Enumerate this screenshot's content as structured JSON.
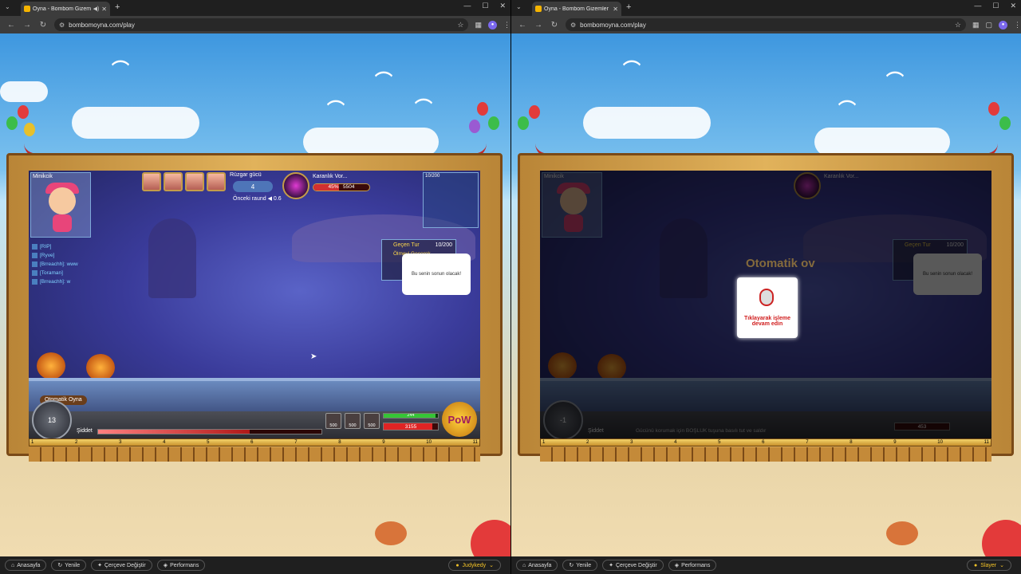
{
  "left": {
    "tab_title": "Oyna - Bombom Gizemler |",
    "url": "bombomoyna.com/play",
    "game": {
      "player_name": "Minikcik",
      "wind_label": "Rüzgar gücü",
      "wind_value": "4",
      "previous_round_label": "Önceki raund",
      "previous_round_value": "0.6",
      "boss_name": "Karanlık Vor...",
      "boss_hp_percent": 45,
      "boss_hp_text": "5504",
      "boss_hp_display": "45%",
      "minimap_top": "10/200",
      "chat": [
        "[RIP]",
        "[Ryve]",
        "[Brreachh]: www",
        "[Toraman]",
        "[Brreachh]: w"
      ],
      "turn_label": "Geçen Tur",
      "turn_value": "10/200",
      "objective_label": "Ölmeyi Geçerek",
      "speech": "Bu senin sonun olacak!",
      "auto_play": "Otomatik Oyna",
      "dial_value": "13",
      "power_label": "Şiddet",
      "power_percent": 68,
      "item_costs": [
        "500",
        "500",
        "500"
      ],
      "energy_value": "244",
      "energy_percent": 95,
      "hp_value": "3155",
      "hp_percent": 90,
      "pow_label": "PoW"
    },
    "ruler": [
      "1",
      "2",
      "3",
      "4",
      "5",
      "6",
      "7",
      "8",
      "9",
      "10",
      "11"
    ],
    "bottom": [
      "Anasayfa",
      "Yenile",
      "Çerçeve Değiştir",
      "Performans"
    ],
    "user": "Judykedy"
  },
  "right": {
    "tab_title": "Oyna - Bombom Gizemler Diy...",
    "url": "bombomoyna.com/play",
    "game": {
      "player_name": "Minikcik",
      "auto_title": "Otomatik ov",
      "start_label": "Tıklayarak işleme devam edin",
      "dial_value": "-1",
      "power_label": "Şiddet",
      "hint": "Gücünü korumak için BOŞLUK tuşuna basılı tut ve saldır",
      "hp_value": "453",
      "boss_name": "Karanlık Vor...",
      "turn_label": "Geçen Tur",
      "turn_value": "10/200",
      "speech": "Bu senin sonun olacak!"
    },
    "ruler": [
      "1",
      "2",
      "3",
      "4",
      "5",
      "6",
      "7",
      "8",
      "9",
      "10",
      "11"
    ],
    "bottom": [
      "Anasayfa",
      "Yenile",
      "Çerçeve Değiştir",
      "Performans"
    ],
    "user": "Slayer"
  },
  "colors": {
    "accent": "#f5c428",
    "hp": "#e02424",
    "energy": "#36c436"
  }
}
